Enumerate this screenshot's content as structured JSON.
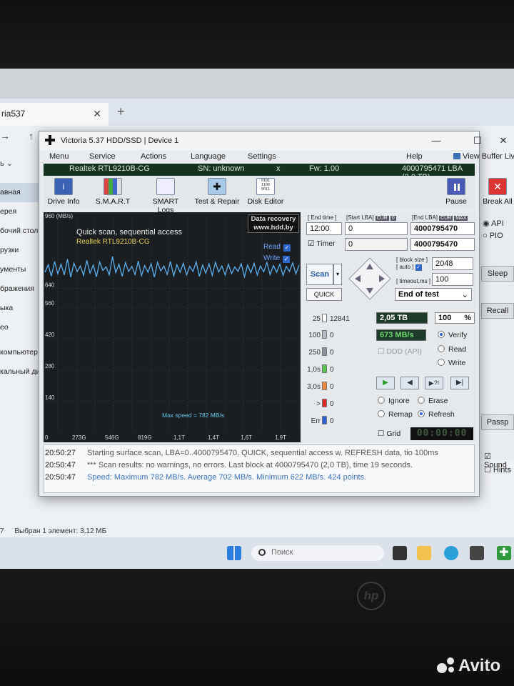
{
  "explorer": {
    "tab_title": "ria537",
    "sidebar": [
      "авная",
      "ерея",
      "бочий стол",
      "рузки",
      "ументы",
      "бражения",
      "ыка",
      "ео",
      "компьютер",
      "кальный ди"
    ],
    "status": "Выбран 1 элемент: 3,12 МБ",
    "status_count": "7"
  },
  "window": {
    "title": "Victoria 5.37 HDD/SSD | Device 1",
    "menu": [
      "Menu",
      "Service",
      "Actions",
      "Language",
      "Settings",
      "Help"
    ],
    "view_buffer": "View Buffer Live"
  },
  "device": {
    "model": "Realtek RTL9210B-CG",
    "sn": "SN: unknown",
    "fw": "Fw: 1.00",
    "lba": "4000795471 LBA (2,0 TB)"
  },
  "toolbar": {
    "drive_info": "Drive Info",
    "smart": "S.M.A.R.T",
    "smart_logs": "SMART Logs",
    "test_repair": "Test & Repair",
    "disk_editor": "Disk Editor",
    "pause": "Pause",
    "break_all": "Break All"
  },
  "graph": {
    "unit_label": "960 (MB/s)",
    "y_ticks": [
      "640",
      "560",
      "420",
      "280",
      "140"
    ],
    "x_ticks": [
      "0",
      "273G",
      "546G",
      "819G",
      "1,1T",
      "1,4T",
      "1,6T",
      "1,9T"
    ],
    "title": "Quick scan, sequential access",
    "subtitle": "Realtek RTL9210B-CG",
    "recovery_line1": "Data recovery",
    "recovery_line2": "www.hdd.by",
    "read_label": "Read",
    "write_label": "Write",
    "max_speed": "Max speed = 782 MB/s"
  },
  "chart_data": {
    "type": "line",
    "ylim": [
      0,
      960
    ],
    "series": [
      {
        "values": [
          712,
          745,
          695,
          760,
          705,
          748,
          700,
          770,
          690,
          752,
          715,
          740,
          698,
          765,
          708,
          744,
          692,
          758,
          720,
          736,
          700,
          782,
          710,
          748,
          694,
          755,
          716,
          738,
          702,
          762,
          697,
          742,
          712,
          750,
          690,
          756,
          718,
          740,
          702,
          760,
          696,
          745,
          712,
          752,
          700,
          738,
          716,
          758,
          694,
          744,
          708,
          750,
          698,
          756,
          713,
          740,
          700,
          748,
          706,
          736,
          716,
          750,
          692,
          744,
          710,
          752,
          700,
          740,
          714,
          756,
          702,
          742,
          712,
          748,
          698,
          738,
          716,
          754,
          705,
          744
        ]
      }
    ]
  },
  "controls": {
    "end_time_label": "[ End time ]",
    "start_lba_label": "[Start LBA]",
    "end_lba_label": "[End LBA]",
    "cur_tag": "CUR",
    "zero_tag": "0",
    "max_tag": "MAX",
    "end_time": "12:00",
    "start_lba": "0",
    "end_lba": "4000795470",
    "timer_label": "Timer",
    "timer_value": "0",
    "end_lba2": "4000795470",
    "block_size_label": "[ block size ]",
    "auto_label": "[ auto ]",
    "block_size": "2048",
    "timeout_label": "[ timeout,ms ]",
    "timeout": "100",
    "scan": "Scan",
    "quick": "QUICK",
    "end_of_test": "End of test"
  },
  "blocks": [
    {
      "label": "25",
      "count": "12841",
      "color": "#ffffff"
    },
    {
      "label": "100",
      "count": "0",
      "color": "#b8bcc4"
    },
    {
      "label": "250",
      "count": "0",
      "color": "#8c919a"
    },
    {
      "label": "1,0s",
      "count": "0",
      "color": "#58c848"
    },
    {
      "label": "3,0s",
      "count": "0",
      "color": "#ef8a3c"
    },
    {
      "label": ">",
      "count": "0",
      "color": "#e02a2a"
    },
    {
      "label": "Err",
      "count": "0",
      "color": "#3060d8"
    }
  ],
  "status": {
    "position": "2,05 TB",
    "percent": "100",
    "percent_sign": "%",
    "speed": "673 MB/s",
    "ddd_api": "DDD (API)",
    "verify": "Verify",
    "read": "Read",
    "write": "Write",
    "ignore": "Ignore",
    "erase": "Erase",
    "remap": "Remap",
    "refresh": "Refresh",
    "grid": "Grid",
    "clock": "00:00:00"
  },
  "sidepanel": {
    "api": "API",
    "pio": "PIO",
    "sleep": "Sleep",
    "recall": "Recall",
    "passp": "Passp",
    "sound": "Sound",
    "hints": "Hints"
  },
  "log": [
    {
      "time": "20:50:27",
      "msg": "Starting surface scan, LBA=0..4000795470, QUICK, sequential access w. REFRESH data, tio 100ms"
    },
    {
      "time": "20:50:47",
      "msg": "*** Scan results: no warnings, no errors. Last block at 4000795470 (2,0 TB), time 19 seconds."
    },
    {
      "time": "20:50:47",
      "msg": "Speed: Maximum 782 MB/s. Average 702 MB/s. Minimum 622 MB/s. 424 points."
    }
  ],
  "taskbar": {
    "search_placeholder": "Поиск"
  },
  "watermark": "Avito"
}
